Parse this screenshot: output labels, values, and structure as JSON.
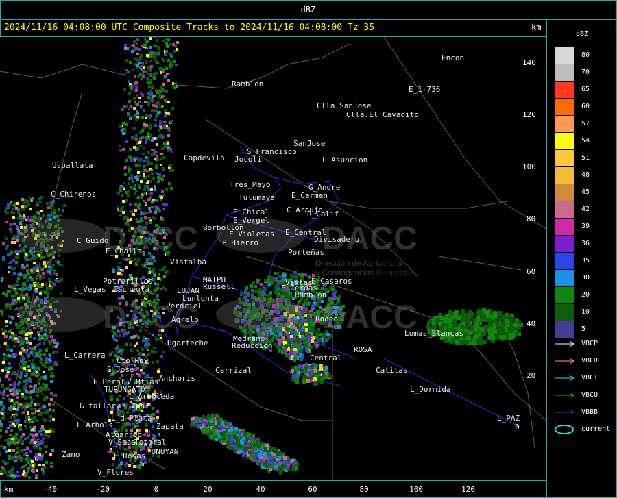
{
  "window": {
    "title": "dBZ"
  },
  "header": {
    "text": "2024/11/16 04:08:00 UTC Composite Tracks to 2024/11/16 04:08:00 Tz 35",
    "unit_right": "km"
  },
  "yaxis": {
    "labels": [
      "140",
      "120",
      "100",
      "80",
      "60",
      "40",
      "20",
      "0"
    ]
  },
  "xaxis": {
    "unit": "km",
    "labels": [
      "-40",
      "-20",
      "0",
      "20",
      "40",
      "60",
      "80",
      "100",
      "120"
    ]
  },
  "legend": {
    "title": "dBZ",
    "entries": [
      {
        "value": "80",
        "color": "#d8d8d8"
      },
      {
        "value": "70",
        "color": "#bdbdbd"
      },
      {
        "value": "65",
        "color": "#ff3a1e"
      },
      {
        "value": "60",
        "color": "#ff6a00"
      },
      {
        "value": "57",
        "color": "#ff9a55"
      },
      {
        "value": "54",
        "color": "#ffff00"
      },
      {
        "value": "51",
        "color": "#ffc83c"
      },
      {
        "value": "48",
        "color": "#f4bb36"
      },
      {
        "value": "45",
        "color": "#d08a3c"
      },
      {
        "value": "42",
        "color": "#cc6a8e"
      },
      {
        "value": "39",
        "color": "#cc2aa8"
      },
      {
        "value": "36",
        "color": "#7a20d0"
      },
      {
        "value": "35",
        "color": "#2a46e6"
      },
      {
        "value": "30",
        "color": "#1a90e6"
      },
      {
        "value": "20",
        "color": "#0d8a0d"
      },
      {
        "value": "10",
        "color": "#0a5e0a"
      },
      {
        "value": "5",
        "color": "#463c96"
      }
    ],
    "tracks": [
      {
        "label": "VBCP",
        "color": "#ffffff"
      },
      {
        "label": "VBCR",
        "color": "#ff9a7a"
      },
      {
        "label": "VBCT",
        "color": "#22e0e0"
      },
      {
        "label": "VBCU",
        "color": "#22cc22"
      },
      {
        "label": "VBBB",
        "color": "#2040ff"
      },
      {
        "label": "current",
        "color": "#22e0e0"
      }
    ]
  },
  "places": [
    "Ramblon",
    "Encon",
    "E_1-736",
    "Clla.SanJose",
    "Clla.El_Cavadito",
    "SanJose",
    "S_Francisco",
    "Jocoli",
    "L_Asuncion",
    "Uspallata",
    "Capdevila",
    "Tres_Mayo",
    "G_Andre",
    "Tulumaya",
    "E_Carmen",
    "C_Chirenos",
    "E_Chical",
    "C_Araujo",
    "E_Vergel",
    "R_Calif",
    "Borbollon",
    "E_Violetas",
    "E_Central",
    "Divisadero",
    "C_Guido",
    "P_Hierro",
    "Porteñas",
    "E_Challa",
    "Vistalba",
    "Potrerillos",
    "E_Casaros",
    "L_Vegas",
    "Cacheuta",
    "LUJAN",
    "Lunlunta",
    "Perdriel",
    "Agrelo",
    "Ugarteche",
    "L_Carrera",
    "Cto_Rey",
    "S_Jose",
    "E_Peral",
    "V_Btias",
    "TUPUNGATO",
    "Anchoris",
    "L_Arboleda",
    "Gltallary",
    "E_Zpal",
    "L_d_Plata",
    "L_Arbols",
    "Algarrob",
    "V_Seca",
    "Totoral",
    "E_Rosas",
    "TUNUYAN",
    "V_Flores",
    "Zapata",
    "Zano",
    "Lomas_Blancas",
    "Catitas",
    "L_Dormida",
    "L_PAZ",
    "Rodeo",
    "Carrizal",
    "Reducción",
    "Central",
    "Medrano",
    "ROSA",
    "Ramblon2",
    "MAIPU",
    "Russell",
    "Vistas",
    "E_Cerdas"
  ],
  "overlay": {
    "wm1": "DACC",
    "wm2": "DACC",
    "wm3": "DACC",
    "wm4": "DACC",
    "sub1": "Direccion de Agricultura",
    "sub2": "y Contingencias Climaticas"
  }
}
